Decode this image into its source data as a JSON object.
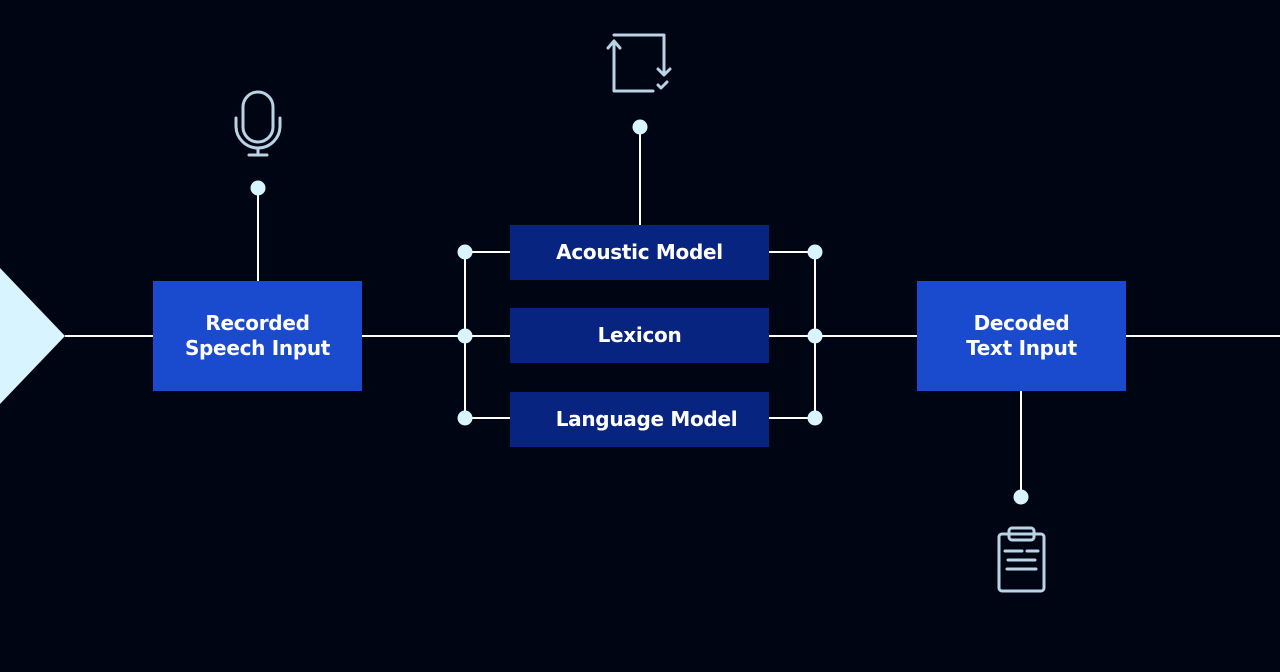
{
  "colors": {
    "background": "#000514",
    "primary_box": "#1a4acd",
    "model_box": "#072480",
    "connector": "#ffffff",
    "node": "#d8f4ff",
    "icon": "#b9d4e4"
  },
  "nodes": {
    "input": {
      "label_line1": "Recorded",
      "label_line2": "Speech Input",
      "icon": "microphone-icon"
    },
    "acoustic": {
      "label": "Acoustic Model"
    },
    "lexicon": {
      "label": "Lexicon"
    },
    "language": {
      "label": "Language Model"
    },
    "output": {
      "label_line1": "Decoded",
      "label_line2": "Text Input",
      "icon": "clipboard-icon"
    },
    "models_icon": "loop-arrows-check-icon"
  }
}
